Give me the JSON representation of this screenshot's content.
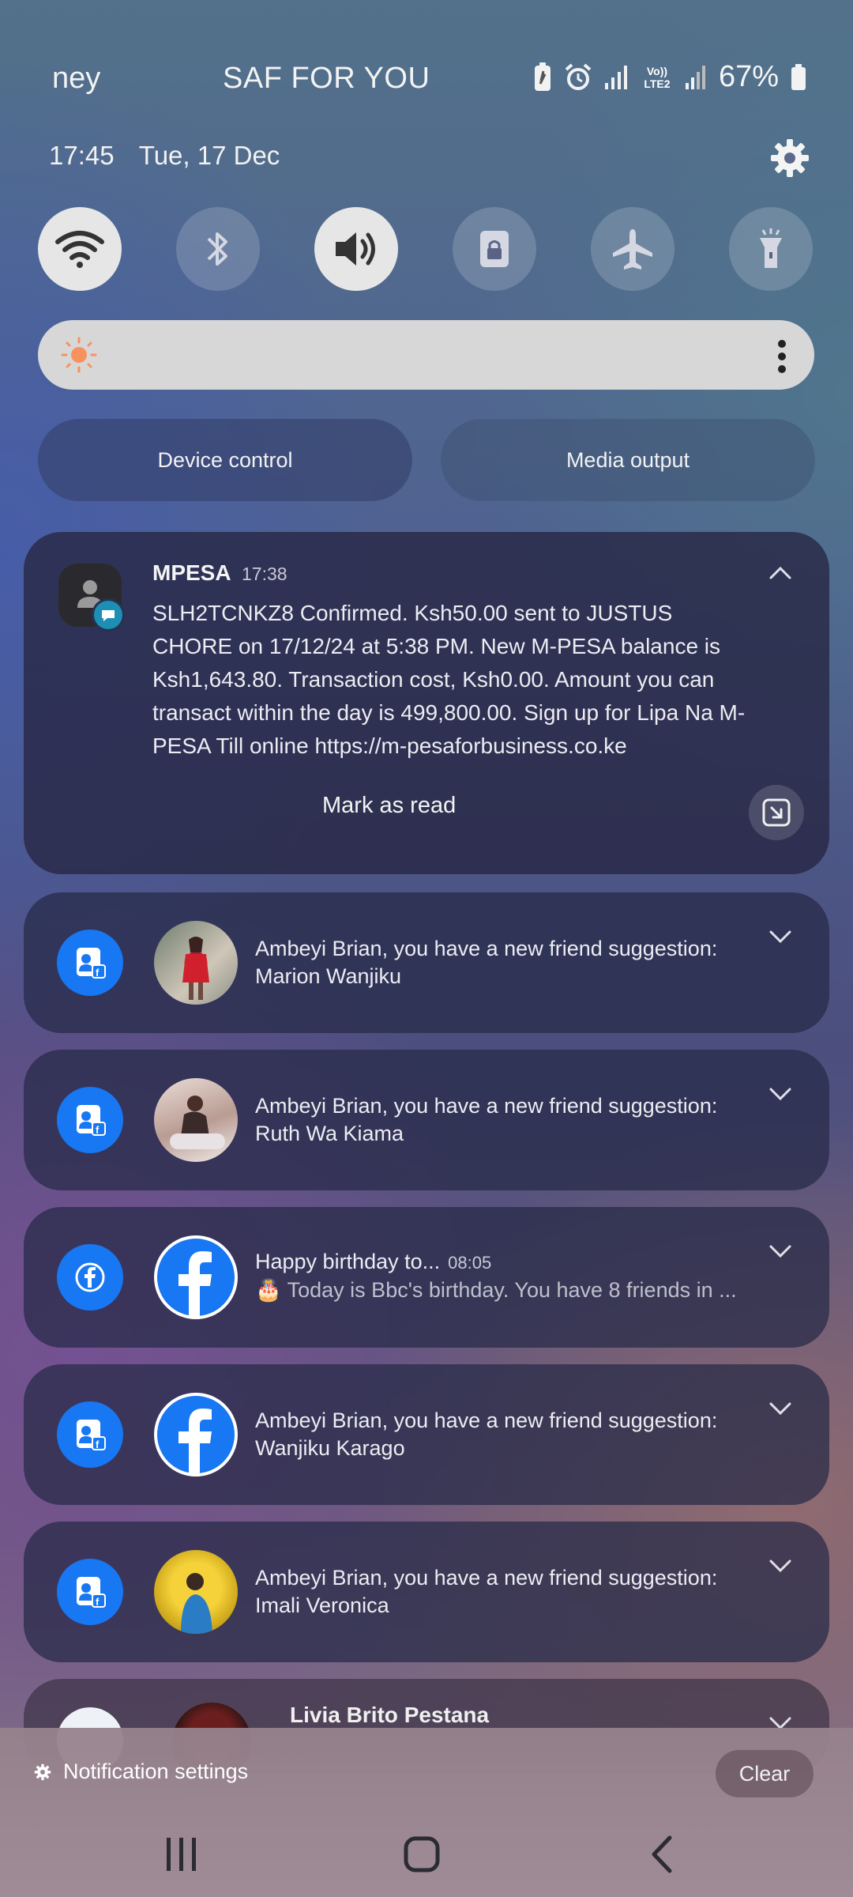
{
  "status_bar": {
    "left_text": "ney",
    "carrier": "SAF FOR YOU",
    "battery_pct": "67%",
    "icons": [
      "battery-saver-icon",
      "alarm-icon",
      "signal-icon",
      "volte-icon",
      "signal-2-icon",
      "battery-icon"
    ],
    "network_label": "Vo)) LTE2"
  },
  "header": {
    "time": "17:45",
    "date": "Tue, 17 Dec"
  },
  "quick_settings": [
    {
      "name": "wifi",
      "icon": "wifi-icon",
      "on": true
    },
    {
      "name": "bluetooth",
      "icon": "bluetooth-icon",
      "on": false
    },
    {
      "name": "sound",
      "icon": "speaker-icon",
      "on": true
    },
    {
      "name": "rotation-lock",
      "icon": "lock-icon",
      "on": false
    },
    {
      "name": "airplane",
      "icon": "airplane-icon",
      "on": false
    },
    {
      "name": "flashlight",
      "icon": "flashlight-icon",
      "on": false
    }
  ],
  "brightness": {
    "level": 0.04
  },
  "buttons": {
    "device_control": "Device control",
    "media_output": "Media output"
  },
  "mpesa": {
    "app": "MPESA",
    "time": "17:38",
    "body": "SLH2TCNKZ8 Confirmed. Ksh50.00 sent to JUSTUS CHORE on 17/12/24 at 5:38 PM. New M-PESA balance is Ksh1,643.80. Transaction cost, Ksh0.00. Amount you can transact within the day is 499,800.00. Sign up for Lipa Na M-PESA Till online https://m-pesaforbusiness.co.ke",
    "action": "Mark as read"
  },
  "notifications": [
    {
      "line1": "Ambeyi Brian, you have a new friend suggestion:",
      "line2": "Marion Wanjiku",
      "icon": "fb-friend-icon"
    },
    {
      "line1": "Ambeyi Brian, you have a new friend suggestion:",
      "line2": "Ruth Wa Kiama",
      "icon": "fb-friend-icon"
    },
    {
      "line1": "Happy birthday to...",
      "time": "08:05",
      "line2": "🎂 Today is Bbc's birthday. You have 8 friends in ...",
      "icon": "facebook-icon"
    },
    {
      "line1": "Ambeyi Brian, you have a new friend suggestion:",
      "line2": "Wanjiku Karago",
      "icon": "fb-friend-icon"
    },
    {
      "line1": "Ambeyi Brian, you have a new friend suggestion:",
      "line2": "Imali Veronica",
      "icon": "fb-friend-icon"
    }
  ],
  "partial": {
    "title": "Livia Brito Pestana"
  },
  "footer": {
    "notification_settings": "Notification settings",
    "clear": "Clear"
  },
  "colors": {
    "facebook_blue": "#1877f2",
    "mpesa_badge": "#1d8fb5",
    "brightness_sun": "#f7925f"
  }
}
